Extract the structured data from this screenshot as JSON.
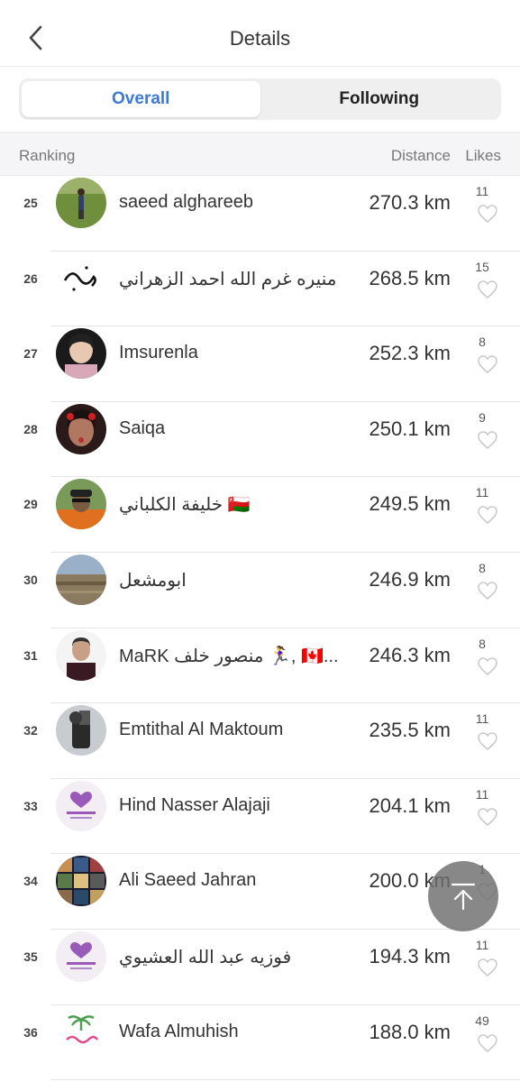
{
  "header": {
    "title": "Details"
  },
  "tabs": [
    {
      "label": "Overall",
      "active": true
    },
    {
      "label": "Following",
      "active": false
    }
  ],
  "columns": {
    "ranking": "Ranking",
    "distance": "Distance",
    "likes": "Likes"
  },
  "rows": [
    {
      "rank": "25",
      "name": "saeed alghareeb",
      "distance": "270.3 km",
      "likes": "11"
    },
    {
      "rank": "26",
      "name": "منيره غرم الله احمد الزهراني",
      "distance": "268.5 km",
      "likes": "15"
    },
    {
      "rank": "27",
      "name": "Imsurenla",
      "distance": "252.3 km",
      "likes": "8"
    },
    {
      "rank": "28",
      "name": "Saiqa",
      "distance": "250.1 km",
      "likes": "9"
    },
    {
      "rank": "29",
      "name": "خليفة  الكلباني 🇴🇲",
      "distance": "249.5 km",
      "likes": "11"
    },
    {
      "rank": "30",
      "name": "ابومشعل",
      "distance": "246.9 km",
      "likes": "8"
    },
    {
      "rank": "31",
      "name": "MaRK  منصور خلف 🏃‍♀️, 🇨🇦...",
      "distance": "246.3 km",
      "likes": "8"
    },
    {
      "rank": "32",
      "name": "Emtithal Al Maktoum",
      "distance": "235.5 km",
      "likes": "11"
    },
    {
      "rank": "33",
      "name": "Hind  Nasser Alajaji",
      "distance": "204.1 km",
      "likes": "11"
    },
    {
      "rank": "34",
      "name": "Ali Saeed Jahran",
      "distance": "200.0 km",
      "likes": "1"
    },
    {
      "rank": "35",
      "name": "فوزيه عبد الله العشيوي",
      "distance": "194.3 km",
      "likes": "11"
    },
    {
      "rank": "36",
      "name": "Wafa   Almuhish",
      "distance": "188.0 km",
      "likes": "49"
    }
  ],
  "icons": {
    "back": "chevron-left-icon",
    "like": "heart-outline-icon",
    "scroll_top": "arrow-up-to-top-icon"
  },
  "colors": {
    "accent": "#3d7ad6",
    "text": "#333333",
    "muted": "#777777",
    "header_bg": "#f5f5f7"
  }
}
